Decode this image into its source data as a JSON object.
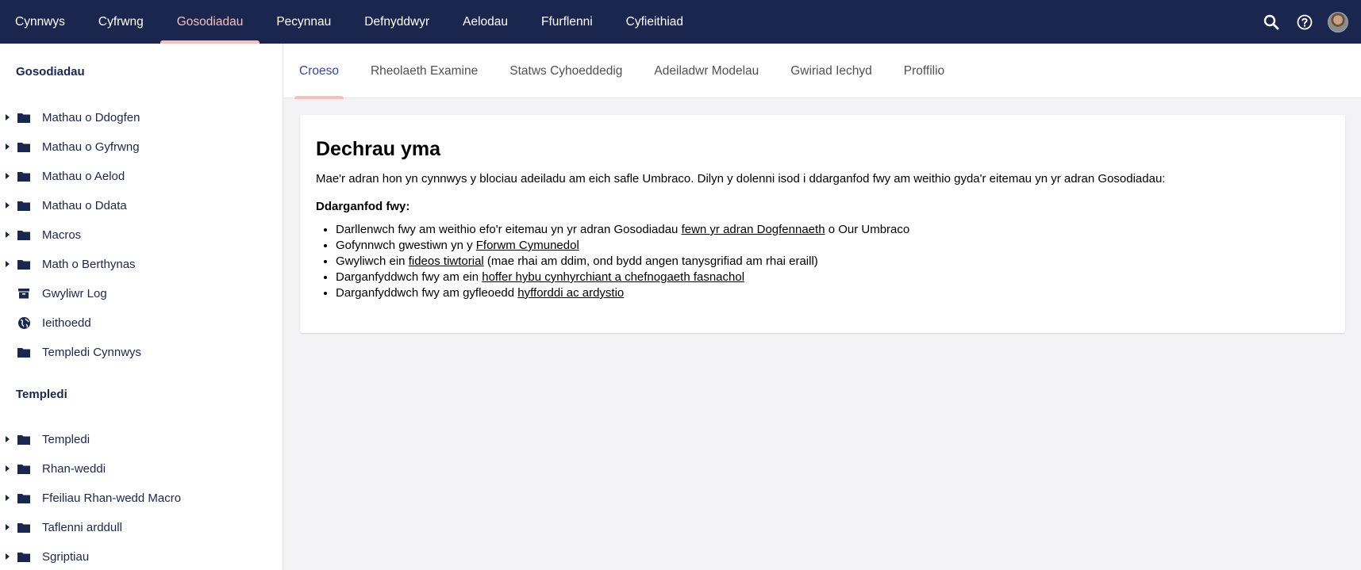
{
  "topnav": {
    "items": [
      {
        "label": "Cynnwys"
      },
      {
        "label": "Cyfrwng"
      },
      {
        "label": "Gosodiadau"
      },
      {
        "label": "Pecynnau"
      },
      {
        "label": "Defnyddwyr"
      },
      {
        "label": "Aelodau"
      },
      {
        "label": "Ffurflenni"
      },
      {
        "label": "Cyfieithiad"
      }
    ],
    "active_index": 2,
    "actions": [
      {
        "icon": "search-icon"
      },
      {
        "icon": "help-icon"
      },
      {
        "icon": "avatar"
      }
    ]
  },
  "sidebar": {
    "settings_title": "Gosodiadau",
    "settings_items": [
      {
        "label": "Mathau o Ddogfen",
        "icon": "folder-icon",
        "expandable": true
      },
      {
        "label": "Mathau o Gyfrwng",
        "icon": "folder-icon",
        "expandable": true
      },
      {
        "label": "Mathau o Aelod",
        "icon": "folder-icon",
        "expandable": true
      },
      {
        "label": "Mathau o Ddata",
        "icon": "folder-icon",
        "expandable": true
      },
      {
        "label": "Macros",
        "icon": "folder-icon",
        "expandable": true
      },
      {
        "label": "Math o Berthynas",
        "icon": "folder-icon",
        "expandable": true
      },
      {
        "label": "Gwyliwr Log",
        "icon": "archive-icon",
        "expandable": false
      },
      {
        "label": "Ieithoedd",
        "icon": "globe-icon",
        "expandable": false
      },
      {
        "label": "Templedi Cynnwys",
        "icon": "folder-icon",
        "expandable": false
      }
    ],
    "templates_title": "Templedi",
    "templates_items": [
      {
        "label": "Templedi",
        "icon": "folder-icon",
        "expandable": true
      },
      {
        "label": "Rhan-weddi",
        "icon": "folder-icon",
        "expandable": true
      },
      {
        "label": "Ffeiliau Rhan-wedd Macro",
        "icon": "folder-icon",
        "expandable": true
      },
      {
        "label": "Taflenni arddull",
        "icon": "folder-icon",
        "expandable": true
      },
      {
        "label": "Sgriptiau",
        "icon": "folder-icon",
        "expandable": true
      }
    ]
  },
  "tabs": {
    "items": [
      {
        "label": "Croeso"
      },
      {
        "label": "Rheolaeth Examine"
      },
      {
        "label": "Statws Cyhoeddedig"
      },
      {
        "label": "Adeiladwr Modelau"
      },
      {
        "label": "Gwiriad Iechyd"
      },
      {
        "label": "Proffilio"
      }
    ],
    "active_index": 0
  },
  "welcome": {
    "heading": "Dechrau yma",
    "intro": "Mae'r adran hon yn cynnwys y blociau adeiladu am eich safle Umbraco. Dilyn y dolenni isod i ddarganfod fwy am weithio gyda'r eitemau yn yr adran Gosodiadau:",
    "discover_label": "Ddarganfod fwy:",
    "list": [
      {
        "before": "Darllenwch fwy am weithio efo'r eitemau yn yr adran Gosodiadau ",
        "link": "fewn yr adran Dogfennaeth",
        "after": " o Our Umbraco"
      },
      {
        "before": "Gofynnwch gwestiwn yn y ",
        "link": "Fforwm Cymunedol",
        "after": ""
      },
      {
        "before": "Gwyliwch ein ",
        "link": "fideos tiwtorial",
        "after": " (mae rhai am ddim, ond bydd angen tanysgrifiad am rhai eraill)"
      },
      {
        "before": "Darganfyddwch fwy am ein ",
        "link": "hoffer hybu cynhyrchiant a chefnogaeth fasnachol",
        "after": ""
      },
      {
        "before": "Darganfyddwch fwy am gyfleoedd ",
        "link": "hyfforddi ac ardystio",
        "after": ""
      }
    ]
  },
  "colors": {
    "topbar_bg": "#1b264f",
    "accent_pink": "#f5c1bc",
    "active_tab_text": "#3544b1",
    "page_bg": "#f3f3f5"
  }
}
